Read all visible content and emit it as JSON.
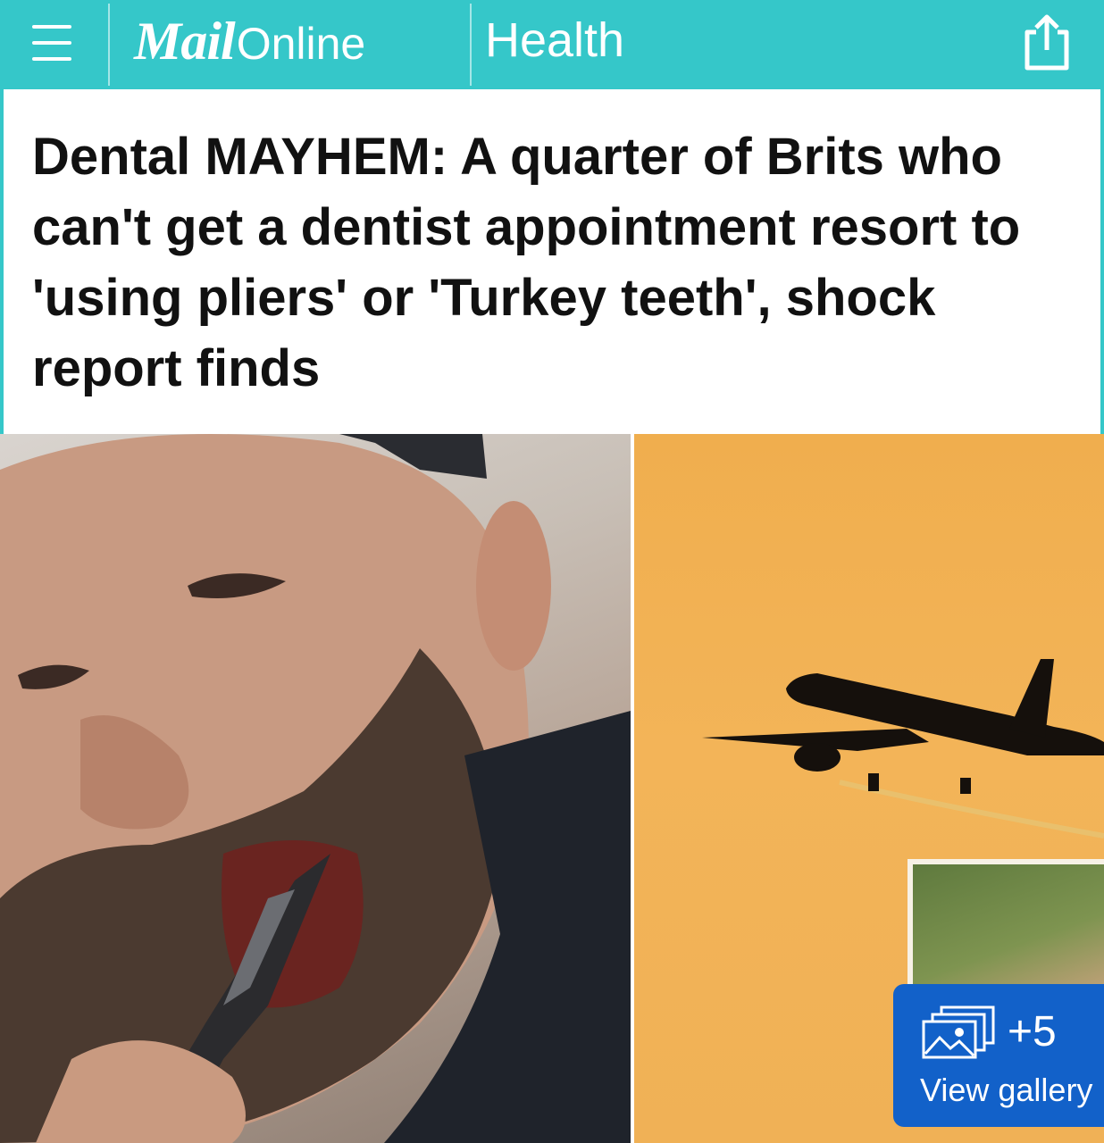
{
  "header": {
    "logo_mail": "Mail",
    "logo_online": "Online",
    "section": "Health",
    "accent_color": "#35c7c9"
  },
  "article": {
    "headline": "Dental MAYHEM: A quarter of Brits who can't get a dentist appointment resort to 'using pliers' or 'Turkey teeth', shock report finds"
  },
  "images": {
    "main": "man-pulling-tooth-with-pliers-photo",
    "secondary": "airplane-silhouette-orange-sky-photo",
    "inset": "hand-holding-teeth-photo"
  },
  "gallery": {
    "count": "+5",
    "label": "View gallery",
    "button_color": "#1261c9"
  }
}
